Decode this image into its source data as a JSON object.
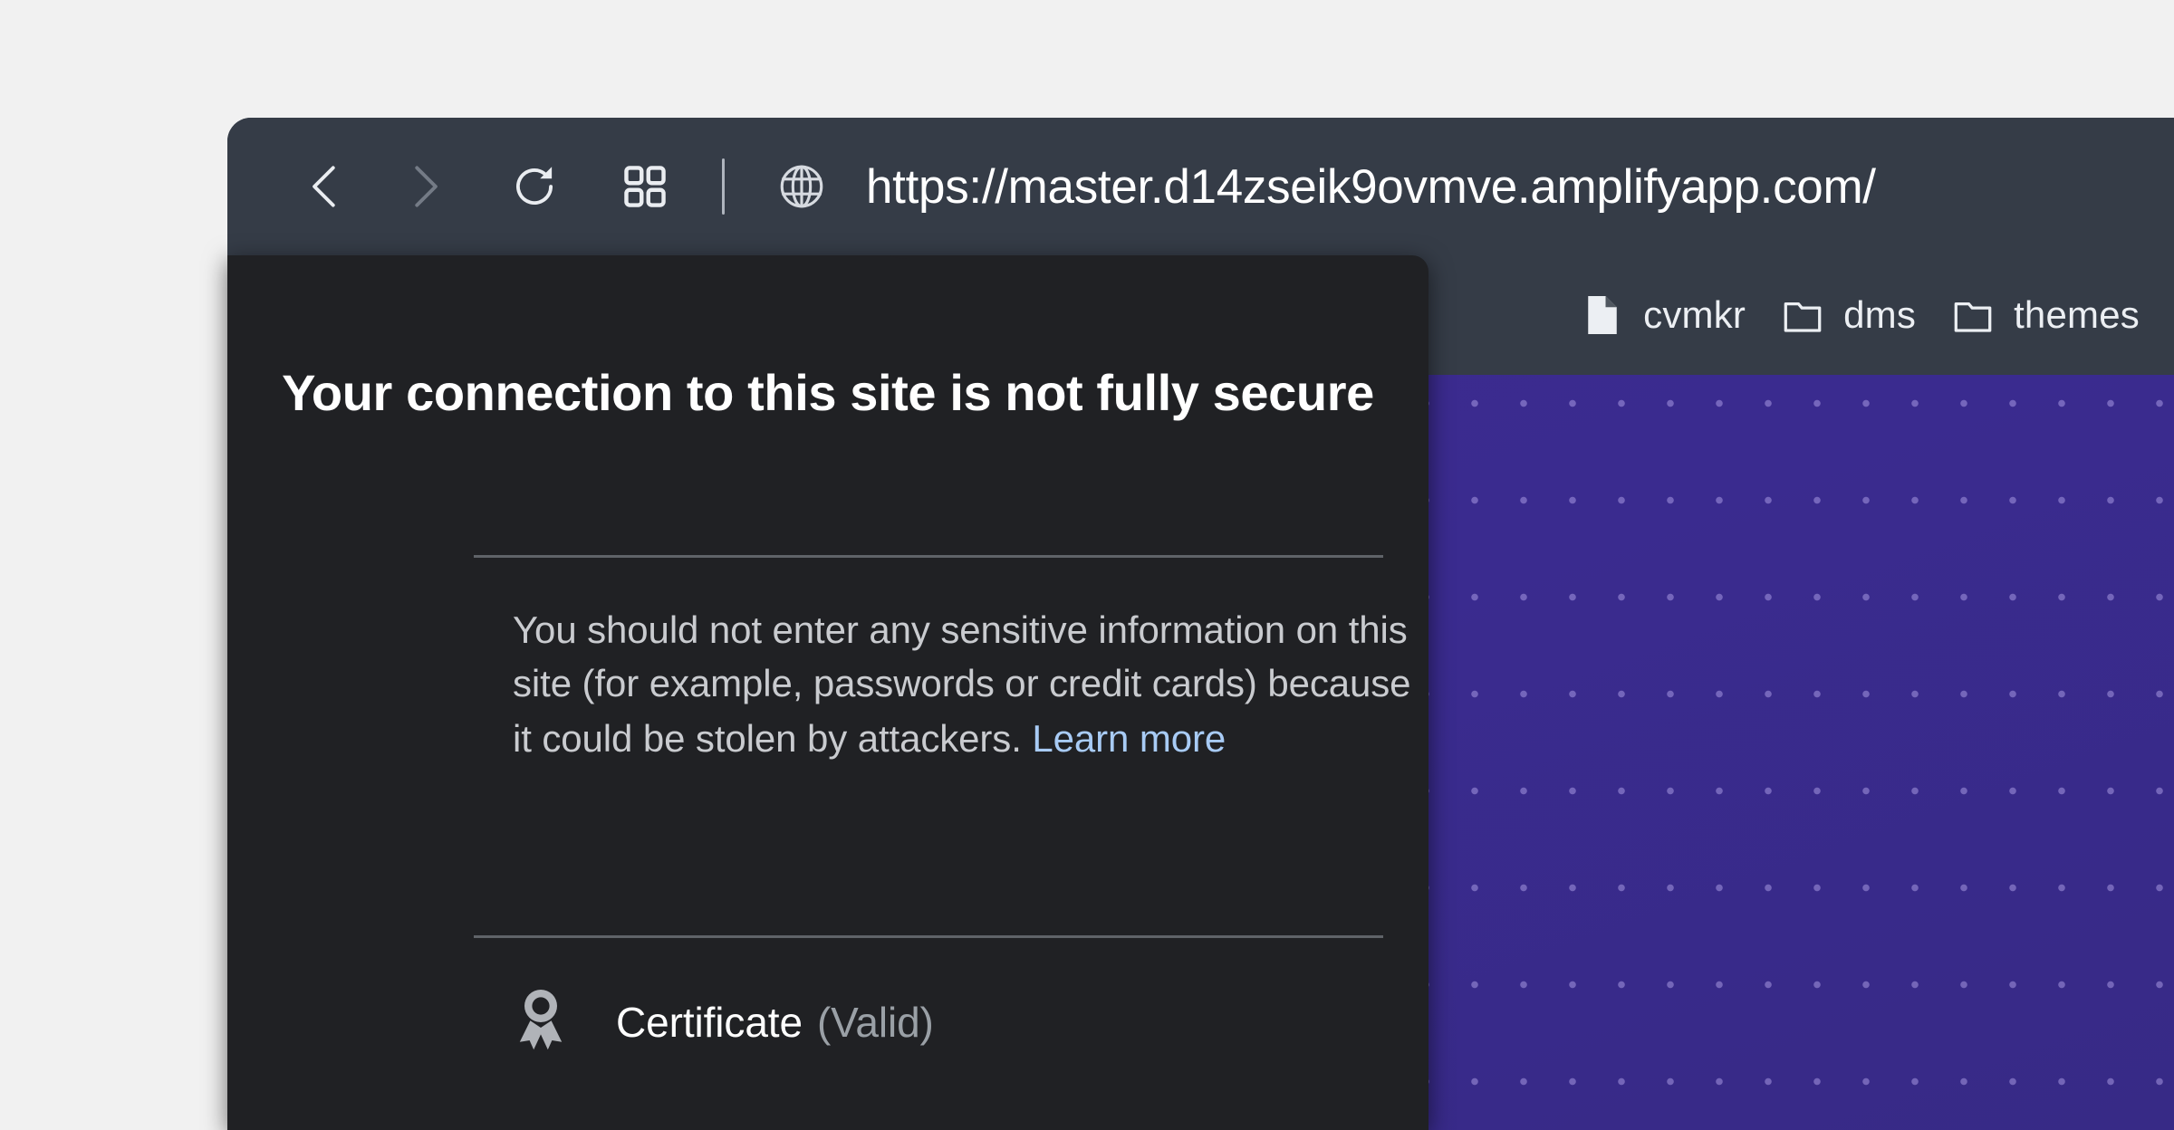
{
  "browser": {
    "toolbar": {
      "back_button": "Back",
      "forward_button": "Forward",
      "reload_button": "Reload",
      "apps_button": "Apps",
      "site_info_button": "View site information",
      "url": "https://master.d14zseik9ovmve.amplifyapp.com/"
    },
    "bookmarks": [
      {
        "label": "cvmkr",
        "icon": "document-icon"
      },
      {
        "label": "dms",
        "icon": "folder-icon"
      },
      {
        "label": "themes",
        "icon": "folder-icon"
      }
    ]
  },
  "security_popup": {
    "title": "Your connection to this site is not fully secure",
    "body": "You should not enter any sensitive information on this site (for example, passwords or credit cards) because it could be stolen by attackers.",
    "learn_more": "Learn more",
    "certificate": {
      "label": "Certificate",
      "status": "(Valid)",
      "icon": "certificate-ribbon-icon"
    }
  },
  "page": {
    "background_color": "#3a2b8f",
    "dot_color": "#cdbeff"
  },
  "colors": {
    "toolbar_bg": "#353c47",
    "popup_bg": "#202124",
    "link": "#a8cbf5",
    "muted_text": "#9aa0a6",
    "body_text": "#c9cbcf",
    "divider": "#5f6368",
    "desktop_bg": "#f1f1f1"
  }
}
